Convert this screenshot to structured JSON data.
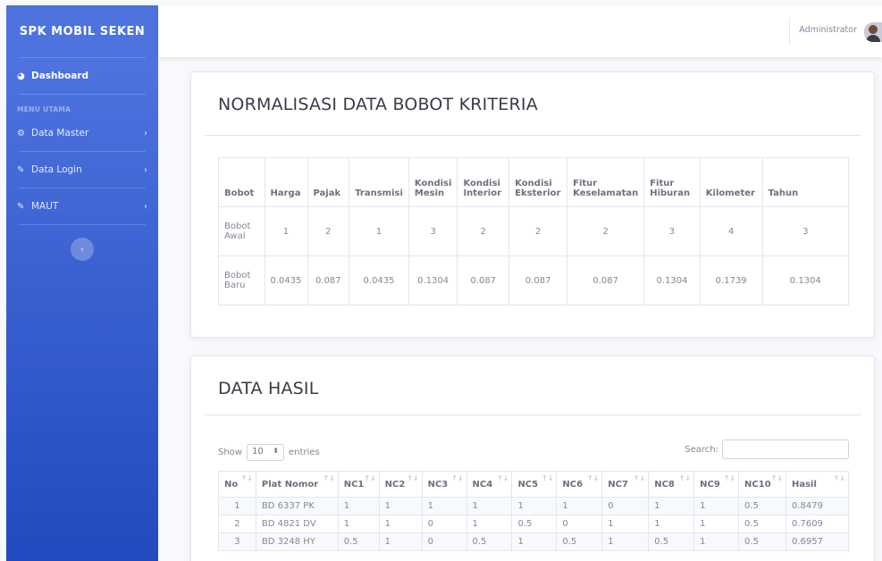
{
  "sidebar": {
    "brand": "SPK MOBIL SEKEN",
    "dashboard": "Dashboard",
    "heading": "MENU UTAMA",
    "items": [
      {
        "label": "Data Master",
        "icon": "gear-icon"
      },
      {
        "label": "Data Login",
        "icon": "wrench-icon"
      },
      {
        "label": "MAUT",
        "icon": "wrench-icon"
      }
    ]
  },
  "topbar": {
    "user": "Administrator"
  },
  "normalisasi": {
    "title": "NORMALISASI DATA BOBOT KRITERIA",
    "headers": [
      "Bobot",
      "Harga",
      "Pajak",
      "Transmisi",
      "Kondisi Mesin",
      "Kondisi Interior",
      "Kondisi Eksterior",
      "Fitur Keselamatan",
      "Fitur Hiburan",
      "Kilometer",
      "Tahun"
    ],
    "rows": [
      [
        "Bobot Awal",
        "1",
        "2",
        "1",
        "3",
        "2",
        "2",
        "2",
        "3",
        "4",
        "3"
      ],
      [
        "Bobot Baru",
        "0.0435",
        "0.087",
        "0.0435",
        "0.1304",
        "0.087",
        "0.087",
        "0.087",
        "0.1304",
        "0.1739",
        "0.1304"
      ]
    ]
  },
  "hasil": {
    "title": "DATA HASIL",
    "show_label": "Show",
    "entries_value": "10",
    "entries_label": "entries",
    "search_label": "Search:",
    "search_value": "",
    "headers": [
      "No",
      "Plat Nomor",
      "NC1",
      "NC2",
      "NC3",
      "NC4",
      "NC5",
      "NC6",
      "NC7",
      "NC8",
      "NC9",
      "NC10",
      "Hasil"
    ],
    "rows": [
      [
        "1",
        "BD 6337 PK",
        "1",
        "1",
        "1",
        "1",
        "1",
        "1",
        "0",
        "1",
        "1",
        "0.5",
        "0.8479"
      ],
      [
        "2",
        "BD 4821 DV",
        "1",
        "1",
        "0",
        "1",
        "0.5",
        "0",
        "1",
        "1",
        "1",
        "0.5",
        "0.7609"
      ],
      [
        "3",
        "BD 3248 HY",
        "0.5",
        "1",
        "0",
        "0.5",
        "1",
        "0.5",
        "1",
        "0.5",
        "1",
        "0.5",
        "0.6957"
      ]
    ]
  }
}
